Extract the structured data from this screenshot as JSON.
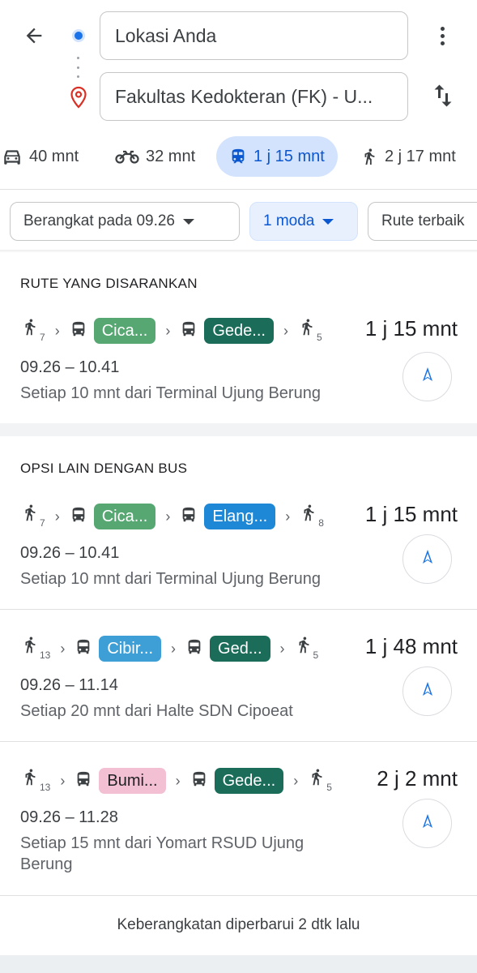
{
  "header": {
    "origin": "Lokasi Anda",
    "destination": "Fakultas Kedokteran (FK) - U..."
  },
  "modes": [
    {
      "icon": "car-icon",
      "label": "40 mnt"
    },
    {
      "icon": "motorcycle-icon",
      "label": "32 mnt"
    },
    {
      "icon": "transit-icon",
      "label": "1 j 15 mnt",
      "active": true
    },
    {
      "icon": "walk-icon",
      "label": "2 j 17 mnt"
    }
  ],
  "filters": [
    {
      "label": "Berangkat pada 09.26"
    },
    {
      "label": "1 moda",
      "active": true
    },
    {
      "label": "Rute terbaik"
    }
  ],
  "sections": {
    "suggested_title": "RUTE YANG DISARANKAN",
    "other_title": "OPSI LAIN DENGAN BUS"
  },
  "routes": [
    {
      "walk_start": "7",
      "bus1": "Cica...",
      "bus1_color": "#57a773",
      "bus2": "Gede...",
      "bus2_color": "#1b6d5a",
      "walk_end": "5",
      "duration": "1 j 15 mnt",
      "times": "09.26 – 10.41",
      "freq": "Setiap 10 mnt dari Terminal Ujung Berung"
    },
    {
      "walk_start": "7",
      "bus1": "Cica...",
      "bus1_color": "#57a773",
      "bus2": "Elang...",
      "bus2_color": "#1e88d7",
      "walk_end": "8",
      "duration": "1 j 15 mnt",
      "times": "09.26 – 10.41",
      "freq": "Setiap 10 mnt dari Terminal Ujung Berung"
    },
    {
      "walk_start": "13",
      "bus1": "Cibir...",
      "bus1_color": "#3d9fd6",
      "bus2": "Ged...",
      "bus2_color": "#1b6d5a",
      "walk_end": "5",
      "duration": "1 j 48 mnt",
      "times": "09.26 – 11.14",
      "freq": "Setiap 20 mnt dari Halte SDN Cipoeat"
    },
    {
      "walk_start": "13",
      "bus1": "Bumi...",
      "bus1_color": "#f3bfd3",
      "bus1_text": "#202124",
      "bus2": "Gede...",
      "bus2_color": "#1b6d5a",
      "walk_end": "5",
      "duration": "2 j 2 mnt",
      "times": "09.26 – 11.28",
      "freq": "Setiap 15 mnt dari Yomart RSUD Ujung Berung"
    }
  ],
  "footer": "Keberangkatan diperbarui 2 dtk lalu"
}
